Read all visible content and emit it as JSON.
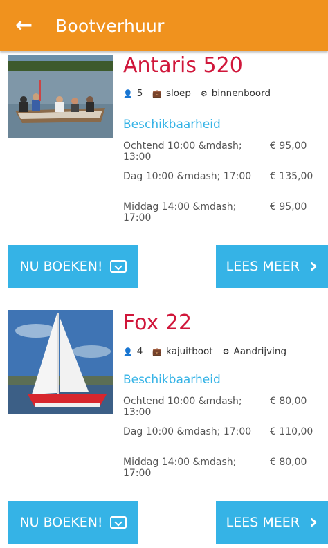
{
  "header": {
    "title": "Bootverhuur",
    "back_icon": "arrow-left-icon"
  },
  "boats": [
    {
      "name": "Antaris 520",
      "specs": {
        "persons": "5",
        "type": "sloep",
        "engine": "binnenboord"
      },
      "availability_title": "Beschikbaarheid",
      "prices": [
        {
          "label": "Ochtend 10:00 &mdash; 13:00",
          "price": "€ 95,00"
        },
        {
          "label": "Dag 10:00 &mdash; 17:00",
          "price": "€ 135,00"
        },
        {
          "label": "Middag 14:00 &mdash; 17:00",
          "price": "€ 95,00"
        }
      ],
      "book_label": "NU BOEKEN!",
      "more_label": "LEES MEER"
    },
    {
      "name": "Fox 22",
      "specs": {
        "persons": "4",
        "type": "kajuitboot",
        "engine": "Aandrijving"
      },
      "availability_title": "Beschikbaarheid",
      "prices": [
        {
          "label": "Ochtend 10:00 &mdash; 13:00",
          "price": "€ 80,00"
        },
        {
          "label": "Dag 10:00 &mdash; 17:00",
          "price": "€ 110,00"
        },
        {
          "label": "Middag 14:00 &mdash; 17:00",
          "price": "€ 80,00"
        }
      ],
      "book_label": "NU BOEKEN!",
      "more_label": "LEES MEER"
    }
  ],
  "colors": {
    "header": "#f0921e",
    "accent": "#35b3e6",
    "title": "#d0163a"
  }
}
